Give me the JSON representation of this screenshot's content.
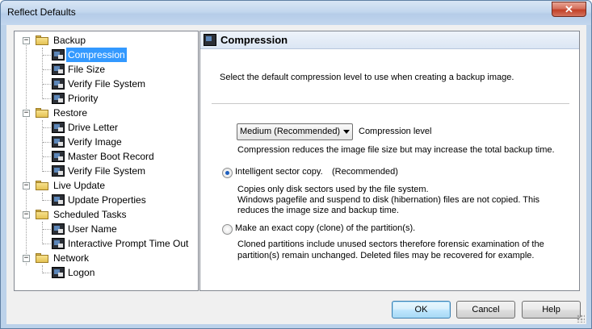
{
  "window": {
    "title": "Reflect Defaults",
    "close_label": "✕"
  },
  "tree": {
    "groups": [
      {
        "label": "Backup",
        "expander": "−",
        "items": [
          "Compression",
          "File Size",
          "Verify File System",
          "Priority"
        ]
      },
      {
        "label": "Restore",
        "expander": "−",
        "items": [
          "Drive Letter",
          "Verify Image",
          "Master Boot Record",
          "Verify File System"
        ]
      },
      {
        "label": "Live Update",
        "expander": "−",
        "items": [
          "Update Properties"
        ]
      },
      {
        "label": "Scheduled Tasks",
        "expander": "−",
        "items": [
          "User Name",
          "Interactive Prompt Time Out"
        ]
      },
      {
        "label": "Network",
        "expander": "−",
        "items": [
          "Logon"
        ]
      }
    ],
    "selected": "Compression"
  },
  "content": {
    "header_title": "Compression",
    "intro": "Select the default compression level to use when creating a backup image.",
    "compression_select": {
      "value": "Medium (Recommended)",
      "label": "Compression level"
    },
    "compression_note": "Compression reduces the image file size but may increase the total backup time.",
    "option_intelligent": {
      "label": "Intelligent sector copy.",
      "recommended": "(Recommended)",
      "desc_line1": "Copies only disk sectors used by the file system.",
      "desc_line2": "Windows pagefile and suspend to disk (hibernation) files are not copied. This",
      "desc_line3": "reduces the image size and backup time.",
      "checked": true
    },
    "option_exact": {
      "label": "Make an exact copy (clone) of the partition(s).",
      "desc_line1": "Cloned partitions include unused sectors therefore forensic examination of the",
      "desc_line2": "partition(s) remain unchanged. Deleted files may be recovered for example.",
      "checked": false
    }
  },
  "buttons": {
    "ok": "OK",
    "cancel": "Cancel",
    "help": "Help"
  }
}
